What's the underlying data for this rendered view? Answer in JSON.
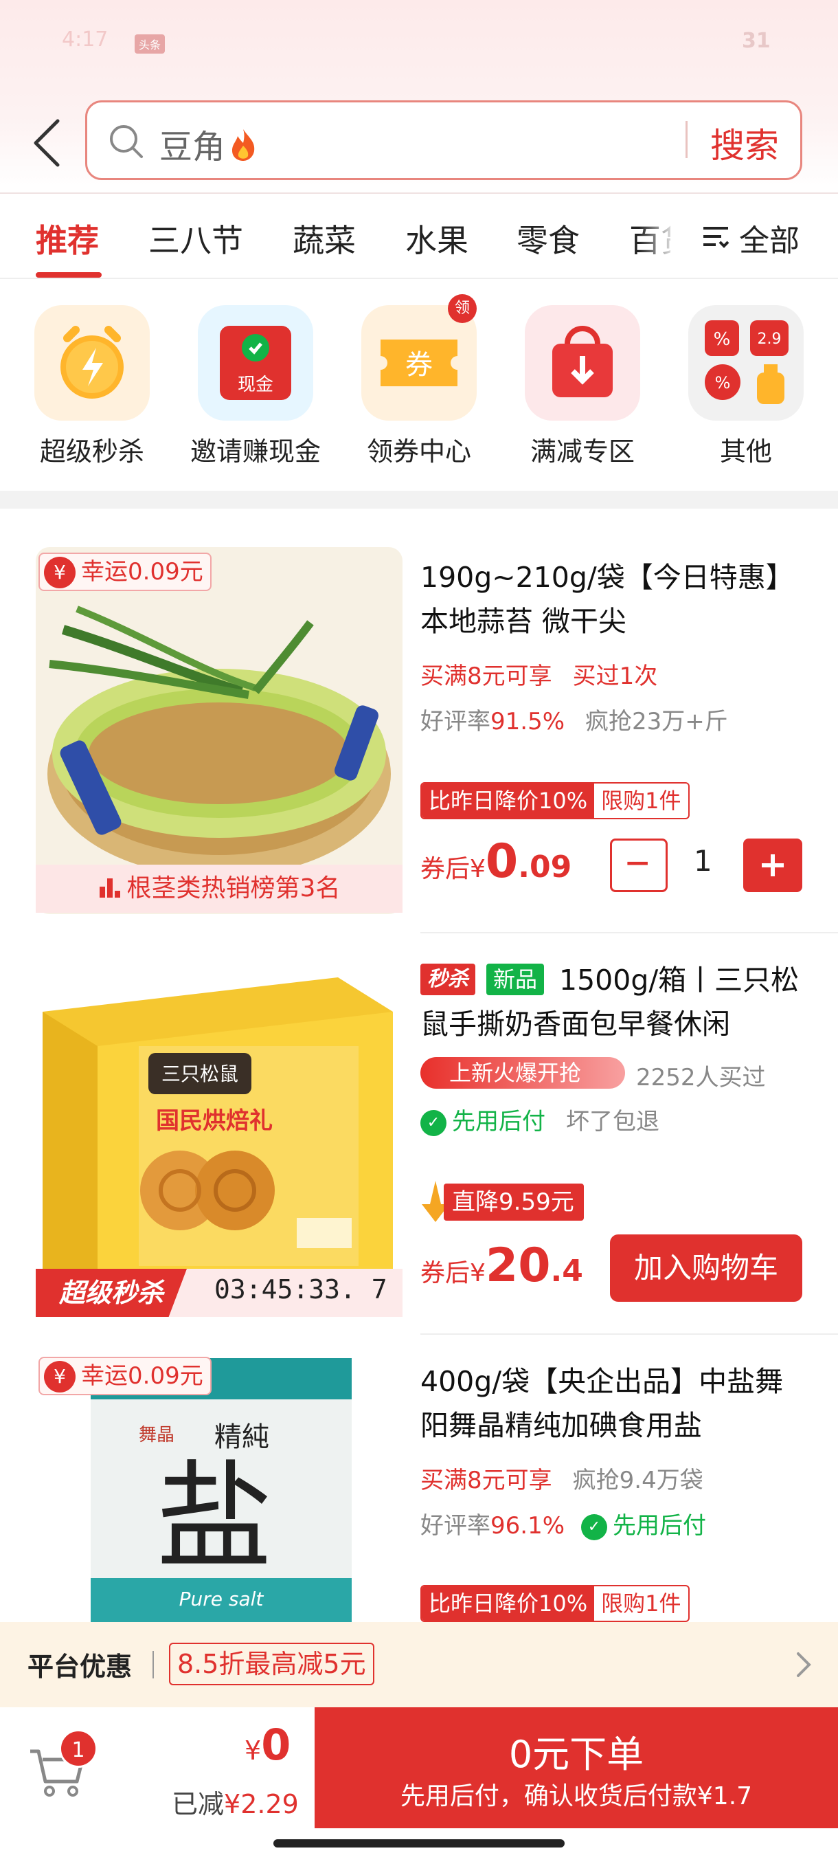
{
  "status_bar": {
    "left_text": "4:17",
    "badge": "头条",
    "battery": "31"
  },
  "search": {
    "query": "豆角",
    "query_icon": "fire-icon",
    "button_label": "搜索"
  },
  "tabs": [
    {
      "label": "推荐"
    },
    {
      "label": "三八节"
    },
    {
      "label": "蔬菜"
    },
    {
      "label": "水果"
    },
    {
      "label": "零食"
    },
    {
      "label": "百货"
    }
  ],
  "tab_all_label": "全部",
  "entries": [
    {
      "label": "超级秒杀",
      "icon": "alarm-clock-icon"
    },
    {
      "label": "邀请赚现金",
      "icon": "cash-icon",
      "icon_text": "现金"
    },
    {
      "label": "领券中心",
      "icon": "coupon-icon",
      "icon_text": "券",
      "tag": "领"
    },
    {
      "label": "满减专区",
      "icon": "shopping-bag-icon"
    },
    {
      "label": "其他",
      "icon": "discount-tags-icon",
      "icon_text": "2.9"
    }
  ],
  "products": [
    {
      "title": "190g~210g/袋【今日特惠】本地蒜苔 微干尖",
      "badge": "幸运0.09元",
      "rank": "根茎类热销榜第3名",
      "promo_1": "买满8元可享",
      "promo_2": "买过1次",
      "rating_label": "好评率",
      "rating": "91.5%",
      "sold": "疯抢23万+斤",
      "pill_a": "比昨日降价10%",
      "pill_b": "限购1件",
      "price_label": "券后¥",
      "price_int": "0",
      "price_dec": ".09",
      "quantity": "1"
    },
    {
      "tag_a": "秒杀",
      "tag_b": "新品",
      "title": "1500g/箱丨三只松鼠手撕奶香面包早餐休闲",
      "hot": "上新火爆开抢",
      "bought": "2252人买过",
      "pay_later": "先用后付",
      "guarantee": "坏了包退",
      "drop": "直降9.59元",
      "price_label": "券后¥",
      "price_int": "20",
      "price_dec": ".4",
      "button": "加入购物车",
      "flash_label": "超级秒杀",
      "timer": "03:45:33. 7",
      "image_text_brand": "三只松鼠",
      "image_text_gift": "国民烘焙礼"
    },
    {
      "title": "400g/袋【央企出品】中盐舞阳舞晶精纯加碘食用盐",
      "badge": "幸运0.09元",
      "promo_1": "买满8元可享",
      "sold": "疯抢9.4万袋",
      "rating_label": "好评率",
      "rating": "96.1%",
      "pay_later": "先用后付",
      "pill_a": "比昨日降价10%",
      "pill_b": "限购1件",
      "image_text_big": "盐",
      "image_text_top": "精純",
      "image_text_en": "Pure salt",
      "image_text_brand": "舞晶"
    }
  ],
  "platform": {
    "label": "平台优惠",
    "offer": "8.5折最高减5元"
  },
  "cart": {
    "count": "1",
    "total_symbol": "¥",
    "total": "0",
    "reduced_label": "已减",
    "reduced": "¥2.29",
    "order_button": "0元下单",
    "order_sub": "先用后付，确认收货后付款¥1.7"
  },
  "colors": {
    "accent": "#e0312e",
    "green": "#12b347",
    "promo_bg": "#fdf3e4"
  }
}
